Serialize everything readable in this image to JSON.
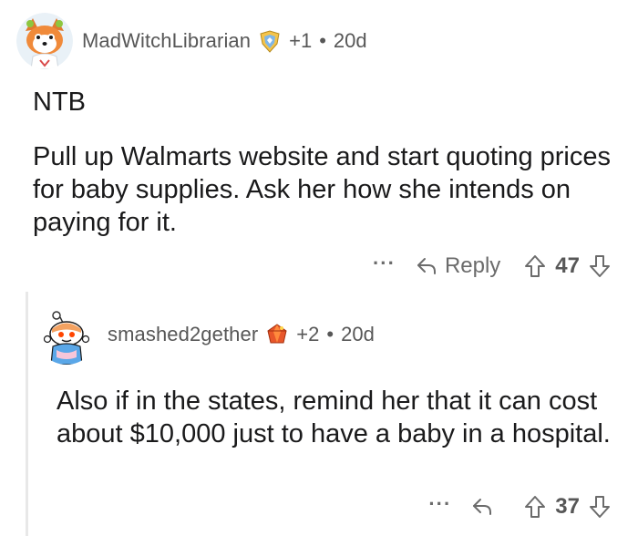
{
  "comments": [
    {
      "username": "MadWitchLibrarian",
      "score": "+1",
      "age": "20d",
      "body": [
        "NTB",
        "Pull up Walmarts website and start quoting prices for baby supplies. Ask her how she intends on paying for it."
      ],
      "reply_label": "Reply",
      "votes": "47",
      "more_label": "···"
    },
    {
      "username": "smashed2gether",
      "score": "+2",
      "age": "20d",
      "body": [
        "Also if in the states, remind her that it can cost about $10,000 just to have a baby in a hospital."
      ],
      "reply_label": "",
      "votes": "37",
      "more_label": "···"
    }
  ],
  "separator": "•",
  "colors": {
    "text": "#1a1a1b",
    "meta": "#575757",
    "icon": "#6b6b6b"
  },
  "icons": {
    "avatar_1": "fox-snoo-avatar",
    "flair_1": "shield-award-icon",
    "avatar_2": "snoo-avatar",
    "flair_2": "ruby-award-icon",
    "reply": "reply-arrow-icon",
    "upvote": "upvote-arrow-icon",
    "downvote": "downvote-arrow-icon"
  }
}
